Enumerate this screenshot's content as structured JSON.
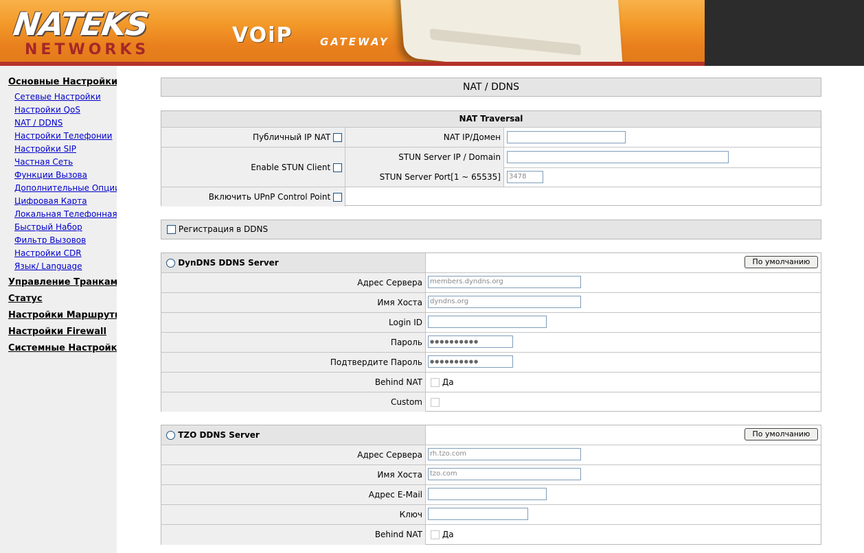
{
  "header": {
    "logo_top": "NATEKS",
    "logo_bottom": "NETWORKS",
    "product_big": "VOiP",
    "product_small": "GATEWAY"
  },
  "sidebar": {
    "sections": [
      {
        "label": "Основные Настройки",
        "items": [
          "Сетевые Настройки",
          "Настройки QoS",
          "NAT / DDNS",
          "Настройки Телефонии",
          "Настройки SIP",
          "Частная Сеть",
          "Функции Вызова",
          "Дополнительные Опции",
          "Цифровая Карта",
          "Локальная Телефонная К",
          "Быстрый Набор",
          "Фильтр Вызовов",
          "Настройки CDR",
          "Язык/ Language"
        ]
      },
      {
        "label": "Управление Транкам"
      },
      {
        "label": "Статус"
      },
      {
        "label": "Настройки Маршрути"
      },
      {
        "label": "Настройки Firewall"
      },
      {
        "label": "Системные Настройк"
      }
    ]
  },
  "page_title": "NAT / DDNS",
  "nat": {
    "title": "NAT Traversal",
    "public_ip_label": "Публичный IP NAT",
    "nat_ip_label": "NAT IP/Домен",
    "nat_ip_value": "",
    "stun_enable_label": "Enable STUN Client",
    "stun_ip_label": "STUN Server IP / Domain",
    "stun_ip_value": "",
    "stun_port_label": "STUN Server Port[1 ~ 65535]",
    "stun_port_value": "3478",
    "upnp_label": "Включить UPnP Control Point"
  },
  "ddns_register_label": "Регистрация в DDNS",
  "dyndns": {
    "title": "DynDNS DDNS Server",
    "default_button": "По умолчанию",
    "rows": [
      {
        "label": "Адрес Сервера",
        "value": "members.dyndns.org"
      },
      {
        "label": "Имя Хоста",
        "value": "dyndns.org"
      },
      {
        "label": "Login ID",
        "value": ""
      },
      {
        "label": "Пароль",
        "value": "●●●●●●●●●●"
      },
      {
        "label": "Подтвердите Пароль",
        "value": "●●●●●●●●●●"
      },
      {
        "label": "Behind NAT",
        "value": "Да"
      },
      {
        "label": "Custom",
        "value": ""
      }
    ]
  },
  "tzo": {
    "title": "TZO DDNS Server",
    "default_button": "По умолчанию",
    "rows": [
      {
        "label": "Адрес Сервера",
        "value": "rh.tzo.com"
      },
      {
        "label": "Имя Хоста",
        "value": "tzo.com"
      },
      {
        "label": "Адрес E-Mail",
        "value": ""
      },
      {
        "label": "Ключ",
        "value": ""
      },
      {
        "label": "Behind NAT",
        "value": "Да"
      }
    ]
  }
}
